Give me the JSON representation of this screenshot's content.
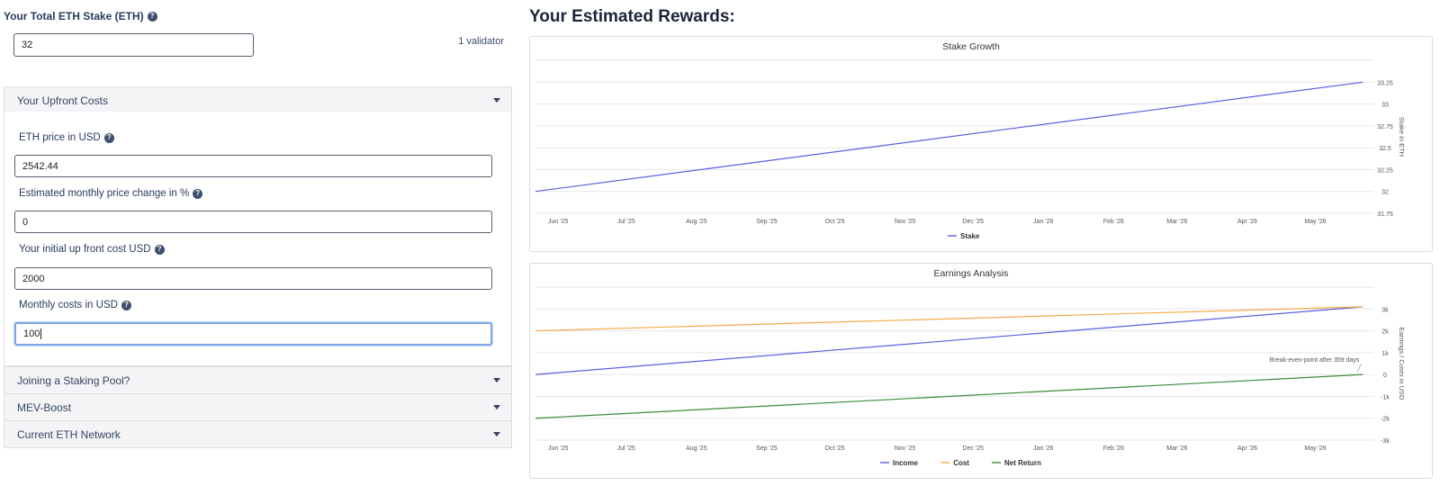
{
  "stake": {
    "label": "Your Total ETH Stake (ETH)",
    "value": "32",
    "validator_text": "1 validator"
  },
  "upfront": {
    "header": "Your Upfront Costs",
    "eth_price_label": "ETH price in USD",
    "eth_price_value": "2542.44",
    "monthly_change_label": "Estimated monthly price change in %",
    "monthly_change_value": "0",
    "initial_cost_label": "Your initial up front cost USD",
    "initial_cost_value": "2000",
    "monthly_costs_label": "Monthly costs in USD",
    "monthly_costs_value": "100"
  },
  "sections": {
    "staking_pool": "Joining a Staking Pool?",
    "mev_boost": "MEV-Boost",
    "network": "Current ETH Network"
  },
  "help_glyph": "?",
  "rewards_title": "Your Estimated Rewards:",
  "colors": {
    "stake": "#5a5fe0",
    "income": "#5a5fe0",
    "cost": "#f5a94a",
    "net_return": "#3a8a3a"
  },
  "chart_data": [
    {
      "type": "line",
      "title": "Stake Growth",
      "xlabel": "",
      "ylabel": "Stake in ETH",
      "x_ticks": [
        "Jun '25",
        "Jul '25",
        "Aug '25",
        "Sep '25",
        "Oct '25",
        "Nov '25",
        "Dec '25",
        "Jan '26",
        "Feb '26",
        "Mar '26",
        "Apr '26",
        "May '26"
      ],
      "y_ticks": [
        "31.75",
        "32",
        "32.25",
        "32.5",
        "32.75",
        "33",
        "33.25"
      ],
      "ylim": [
        31.75,
        33.5
      ],
      "xlim": [
        "2025-05-22",
        "2026-05-27"
      ],
      "grid": true,
      "y_axis_side": "right",
      "legend_position": "bottom",
      "series": [
        {
          "name": "Stake",
          "x": [
            "2025-05-22",
            "2026-05-22"
          ],
          "values": [
            32.0,
            33.25
          ]
        }
      ]
    },
    {
      "type": "line",
      "title": "Earnings Analysis",
      "xlabel": "",
      "ylabel": "Earnings / Costs in USD",
      "x_ticks": [
        "Jun '25",
        "Jul '25",
        "Aug '25",
        "Sep '25",
        "Oct '25",
        "Nov '25",
        "Dec '25",
        "Jan '26",
        "Feb '26",
        "Mar '26",
        "Apr '26",
        "May '26"
      ],
      "y_ticks": [
        "-3k",
        "-2k",
        "-1k",
        "0",
        "1k",
        "2k",
        "3k"
      ],
      "ylim": [
        -3000,
        4000
      ],
      "xlim": [
        "2025-05-22",
        "2026-05-27"
      ],
      "grid": true,
      "y_axis_side": "right",
      "legend_position": "bottom",
      "annotation": "Break-even-point after 359 days",
      "series": [
        {
          "name": "Income",
          "x": [
            "2025-05-22",
            "2026-05-22"
          ],
          "values": [
            0,
            3100
          ]
        },
        {
          "name": "Cost",
          "x": [
            "2025-05-22",
            "2026-05-22"
          ],
          "values": [
            2000,
            3100
          ]
        },
        {
          "name": "Net Return",
          "x": [
            "2025-05-22",
            "2026-05-22"
          ],
          "values": [
            -2000,
            0
          ]
        }
      ]
    }
  ]
}
